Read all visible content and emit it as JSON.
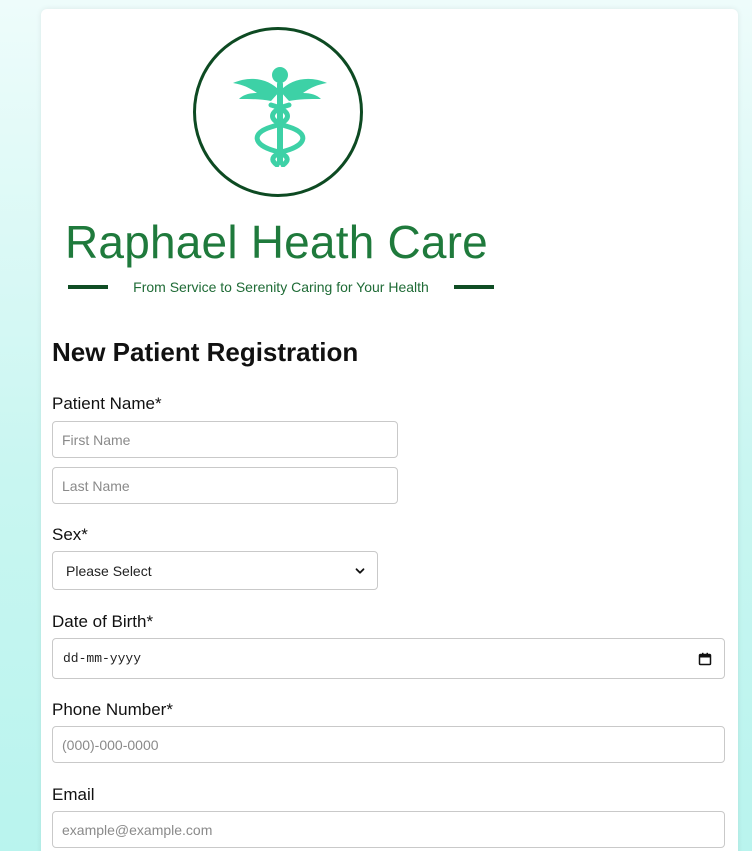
{
  "brand": {
    "name": "Raphael Heath Care",
    "tagline": "From Service to Serenity Caring for Your Health",
    "colors": {
      "primary_green": "#1f7a3c",
      "dark_green": "#0d4a22",
      "emblem_teal": "#3dd1a6"
    },
    "emblem_icon": "caduceus-icon"
  },
  "form": {
    "title": "New Patient Registration",
    "patient_name": {
      "label": "Patient Name",
      "required_mark": "*",
      "first_placeholder": "First Name",
      "last_placeholder": "Last Name"
    },
    "sex": {
      "label": "Sex",
      "required_mark": "*",
      "selected": "Please Select"
    },
    "dob": {
      "label": "Date of Birth",
      "required_mark": "*",
      "value": "dd-mm-yyyy"
    },
    "phone": {
      "label": "Phone Number",
      "required_mark": "*",
      "placeholder": "(000)-000-0000"
    },
    "email": {
      "label": "Email",
      "placeholder": "example@example.com"
    }
  }
}
